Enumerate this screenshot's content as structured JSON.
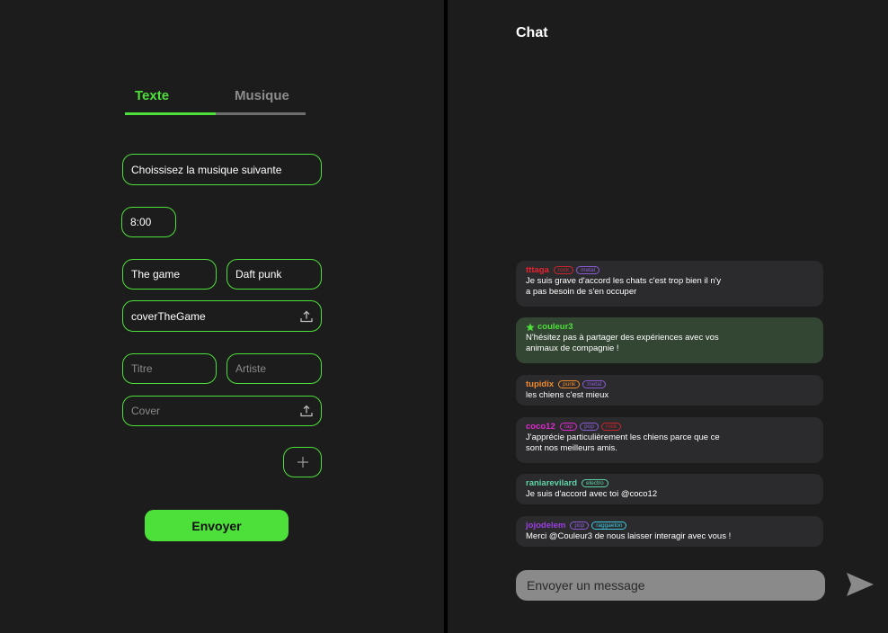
{
  "tabs": [
    {
      "label": "Texte",
      "active": true
    },
    {
      "label": "Musique",
      "active": false
    }
  ],
  "form": {
    "question": "Choissisez la musique suivante",
    "time": "8:00",
    "track1": {
      "title": "The game",
      "artist": "Daft punk",
      "cover": "coverTheGame"
    },
    "track2": {
      "title_placeholder": "Titre",
      "artist_placeholder": "Artiste",
      "cover_placeholder": "Cover"
    },
    "submit_label": "Envoyer"
  },
  "chat": {
    "title": "Chat",
    "messages": [
      {
        "user": "tttaga",
        "user_color": "#e8232f",
        "tags": [
          {
            "label": "rock",
            "color": "#c9242e"
          },
          {
            "label": "metal",
            "color": "#8b5bd6"
          }
        ],
        "lines": [
          "Je suis grave d'accord les chats c'est trop bien il n'y",
          "a pas besoin de s'en occuper"
        ]
      },
      {
        "user": "couleur3",
        "user_color": "#4ee03a",
        "star": true,
        "tags": [],
        "lines": [
          "N'hésitez pas à partager des expériences avec vos",
          "animaux de compagnie !"
        ]
      },
      {
        "user": "tupidix",
        "user_color": "#f08a2c",
        "tags": [
          {
            "label": "punk",
            "color": "#f08a2c"
          },
          {
            "label": "metal",
            "color": "#8b5bd6"
          }
        ],
        "lines": [
          "les chiens c'est mieux"
        ]
      },
      {
        "user": "coco12",
        "user_color": "#e02ad0",
        "tags": [
          {
            "label": "rap",
            "color": "#e02ad0"
          },
          {
            "label": "pop",
            "color": "#8b5bd6"
          },
          {
            "label": "rock",
            "color": "#c9242e"
          }
        ],
        "lines": [
          "J'apprécie particulièrement les chiens parce que ce",
          "sont nos meilleurs amis."
        ]
      },
      {
        "user": "raniarevilard",
        "user_color": "#5ed5a8",
        "tags": [
          {
            "label": "electro",
            "color": "#5ed5a8"
          }
        ],
        "lines": [
          "Je suis d'accord avec toi @coco12"
        ]
      },
      {
        "user": "jojodelem",
        "user_color": "#9a3fe0",
        "tags": [
          {
            "label": "pop",
            "color": "#8b5bd6"
          },
          {
            "label": "raggaeton",
            "color": "#3fc8e0"
          }
        ],
        "lines": [
          "Merci @Couleur3 de nous laisser interagir avec vous !"
        ]
      }
    ],
    "input_placeholder": "Envoyer un message"
  }
}
